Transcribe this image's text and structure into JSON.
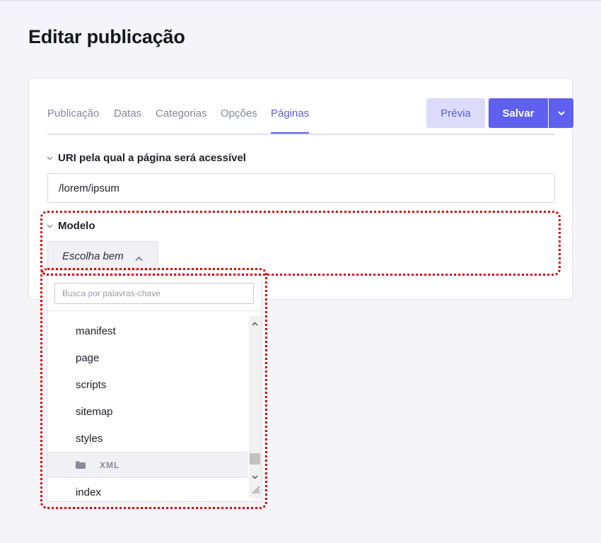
{
  "page": {
    "title": "Editar publicação"
  },
  "tabs": [
    {
      "label": "Publicação",
      "active": false
    },
    {
      "label": "Datas",
      "active": false
    },
    {
      "label": "Categorias",
      "active": false
    },
    {
      "label": "Opções",
      "active": false
    },
    {
      "label": "Páginas",
      "active": true
    }
  ],
  "actions": {
    "preview_label": "Prévia",
    "save_label": "Salvar",
    "save_menu_icon": "chevron-down-icon"
  },
  "uri_section": {
    "label": "URI pela qual a página será acessível",
    "value": "/lorem/ipsum"
  },
  "template_section": {
    "label": "Modelo",
    "select_placeholder": "Escolha bem",
    "search_placeholder": "Busca por palavras-chave",
    "options": [
      "manifest",
      "page",
      "scripts",
      "sitemap",
      "styles"
    ],
    "group": {
      "label": "XML",
      "icon": "folder-icon",
      "options": [
        "index"
      ]
    }
  },
  "colors": {
    "accent": "#5f5ff0",
    "preview_bg": "#dcdcf9",
    "highlight": "#dd0000",
    "background": "#f4f4f9"
  }
}
